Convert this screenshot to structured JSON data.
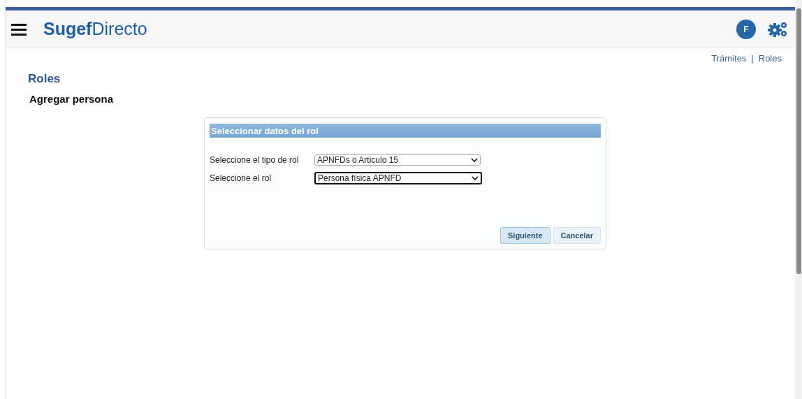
{
  "header": {
    "brand": "**Sugef**Directo",
    "avatar": "F"
  },
  "nav": {
    "links": [
      "Trámites",
      "Roles"
    ],
    "separator": "|"
  },
  "page": {
    "title": "Roles",
    "subtitle": "Agregar persona"
  },
  "panel": {
    "title": "Seleccionar datos del rol",
    "fields": [
      {
        "label": "Seleccione el tipo de rol",
        "value": "APNFDs o Articulo 15",
        "focused": false
      },
      {
        "label": "Seleccione el rol",
        "value": "Persona física APNFD",
        "focused": true
      }
    ],
    "buttons": [
      {
        "label": "Siguiente",
        "focused": true
      },
      {
        "label": "Cancelar",
        "focused": false
      }
    ]
  }
}
